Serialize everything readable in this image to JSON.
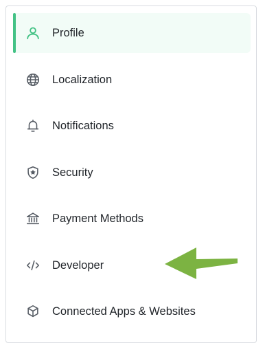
{
  "accent_color": "#43c285",
  "arrow_color": "#7cb342",
  "nav": {
    "items": [
      {
        "label": "Profile",
        "icon": "user-icon",
        "active": true
      },
      {
        "label": "Localization",
        "icon": "globe-icon",
        "active": false
      },
      {
        "label": "Notifications",
        "icon": "bell-icon",
        "active": false
      },
      {
        "label": "Security",
        "icon": "shield-icon",
        "active": false
      },
      {
        "label": "Payment Methods",
        "icon": "bank-icon",
        "active": false
      },
      {
        "label": "Developer",
        "icon": "code-icon",
        "active": false
      },
      {
        "label": "Connected Apps & Websites",
        "icon": "cube-icon",
        "active": false
      }
    ]
  },
  "annotation": {
    "arrow_points_to": "Developer"
  }
}
